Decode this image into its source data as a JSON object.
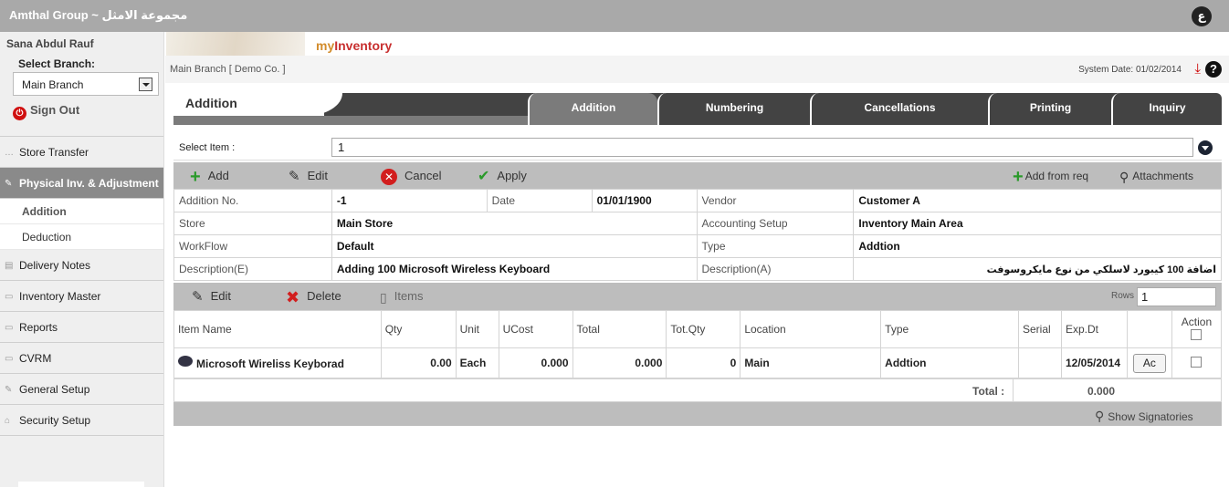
{
  "window": {
    "title": "Amthal Group ~ مجموعة الامثل",
    "lang_toggle": "ع"
  },
  "sidebar": {
    "user": "Sana Abdul Rauf",
    "branch_label": "Select Branch:",
    "branch_value": "Main Branch",
    "signout": "Sign Out",
    "items": [
      {
        "label": "Store Transfer"
      },
      {
        "label": "Physical Inv. & Adjustment"
      },
      {
        "label": "Delivery Notes"
      },
      {
        "label": "Inventory Master"
      },
      {
        "label": "Reports"
      },
      {
        "label": "CVRM"
      },
      {
        "label": "General Setup"
      },
      {
        "label": "Security Setup"
      }
    ],
    "subitems": [
      {
        "label": "Addition"
      },
      {
        "label": "Deduction"
      }
    ]
  },
  "header": {
    "logo_my": "my",
    "logo_inventory": "Inventory",
    "breadcrumb": "Main Branch [ Demo Co. ]",
    "system_date": "System Date: 01/02/2014",
    "help": "?"
  },
  "page": {
    "title": "Addition"
  },
  "tabs": [
    {
      "label": "Addition"
    },
    {
      "label": "Numbering"
    },
    {
      "label": "Cancellations"
    },
    {
      "label": "Printing"
    },
    {
      "label": "Inquiry"
    }
  ],
  "select_item": {
    "label": "Select Item :",
    "value": "1"
  },
  "toolbar": {
    "add": "Add",
    "edit": "Edit",
    "cancel": "Cancel",
    "apply": "Apply",
    "add_from_req": "Add from req",
    "attachments": "Attachments"
  },
  "form": {
    "addition_no_label": "Addition No.",
    "addition_no": "-1",
    "date_label": "Date",
    "date": "01/01/1900",
    "vendor_label": "Vendor",
    "vendor": "Customer A",
    "store_label": "Store",
    "store": "Main Store",
    "accounting_label": "Accounting Setup",
    "accounting": "Inventory Main Area",
    "workflow_label": "WorkFlow",
    "workflow": "Default",
    "type_label": "Type",
    "type": "Addtion",
    "desc_e_label": "Description(E)",
    "desc_e": "Adding 100 Microsoft Wireless Keyboard",
    "desc_a_label": "Description(A)",
    "desc_a": "اضافة 100 كيبورد لاسلكي من نوع مايكروسوفت"
  },
  "grid_toolbar": {
    "edit": "Edit",
    "delete": "Delete",
    "items": "Items",
    "rows_label": "Rows",
    "rows_value": "1"
  },
  "grid": {
    "columns": [
      "Item Name",
      "Qty",
      "Unit",
      "UCost",
      "Total",
      "Tot.Qty",
      "Location",
      "Type",
      "Serial",
      "Exp.Dt",
      "",
      "Action"
    ],
    "rows": [
      {
        "item_name": "Microsoft Wireliss Keyborad",
        "qty": "0.00",
        "unit": "Each",
        "ucost": "0.000",
        "total": "0.000",
        "tot_qty": "0",
        "location": "Main",
        "type": "Addtion",
        "serial": "",
        "exp_dt": "12/05/2014",
        "ac": "Ac"
      }
    ],
    "total_label": "Total :",
    "total_value": "0.000"
  },
  "signatories": "Show Signatories",
  "colors": {
    "accent_green": "#2a9a2a",
    "cancel_red": "#d21e1e",
    "tab_dark": "#434343",
    "tab_active": "#7b7b7b"
  }
}
